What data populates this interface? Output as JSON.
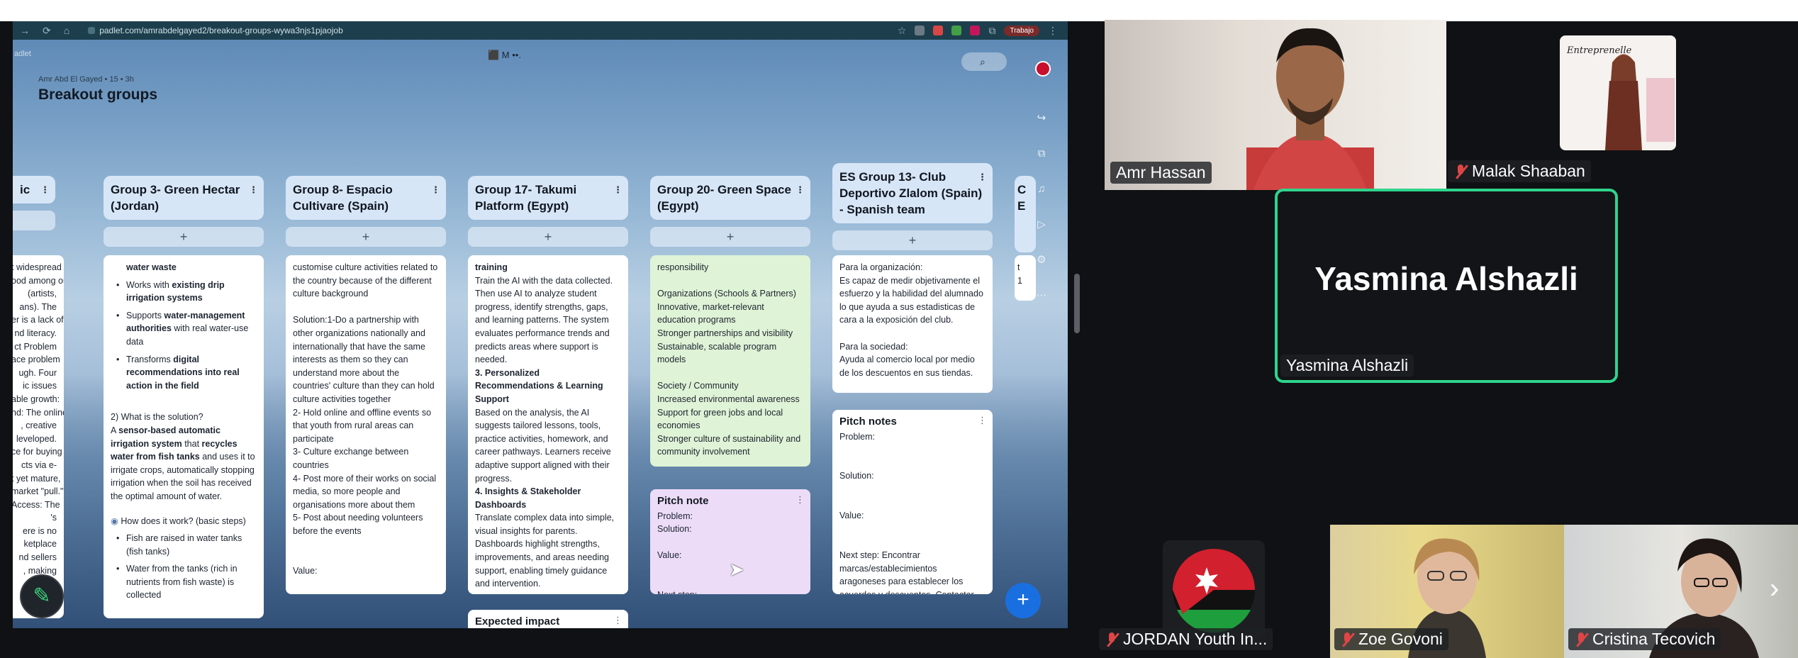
{
  "browser": {
    "url": "padlet.com/amrabdelgayed2/breakout-groups-wywa3njs1pjaojob",
    "profile_label": "Trabajo"
  },
  "board": {
    "app_label": "adlet",
    "byline": "Amr Abd El Gayed • 15 • 3h",
    "title": "Breakout groups",
    "top_icons": "⬛ M ••.",
    "search_icon": "search-icon"
  },
  "columns": [
    {
      "title": "ic",
      "add": "+"
    },
    {
      "title": "Group 3- Green Hectar (Jordan)",
      "add": "+"
    },
    {
      "title": "Group 8- Espacio Cultivare (Spain)",
      "add": "+"
    },
    {
      "title": "Group 17- Takumi Platform (Egypt)",
      "add": "+"
    },
    {
      "title": "Group 20- Green Space (Egypt)",
      "add": "+"
    },
    {
      "title": "ES Group 13- Club Deportivo Zlalom (Spain) - Spanish team",
      "add": "+"
    },
    {
      "title": "C E",
      "add": ""
    }
  ],
  "cards": {
    "col0": [
      "t widespread",
      "ood among our",
      "(artists,",
      "ans). The",
      "er is a lack of",
      "nd literacy.",
      "ct Problem",
      "ace problem",
      "ugh. Four",
      "ic issues",
      "able growth:",
      "nd: The online",
      ", creative",
      "leveloped.",
      "ce for buying",
      "cts via e-",
      "t yet mature,",
      "market \"pull.\"",
      "Access: The",
      "'s",
      "ere is no",
      "ketplace",
      "nd sellers",
      ", making"
    ],
    "col1_top": "water waste",
    "col1_bullets": [
      {
        "pre": "Works with ",
        "bold": "existing drip irrigation systems",
        "post": ""
      },
      {
        "pre": "Supports ",
        "bold": "water-management authorities",
        "post": " with real water-use data"
      },
      {
        "pre": "Transforms ",
        "bold": "digital recommendations into real action in the field",
        "post": ""
      }
    ],
    "col1_q2": "2) What is the solution?",
    "col1_sol_a": "A ",
    "col1_sol_b": "sensor-based automatic irrigation system",
    "col1_sol_c": " that ",
    "col1_sol_d": "recycles water from fish tanks",
    "col1_sol_e": " and uses it to irrigate crops, automatically stopping irrigation when the soil has received the optimal amount of water.",
    "col1_how": "How does it work? (basic steps)",
    "col1_steps": [
      "Fish are raised in water tanks (fish tanks)",
      "Water from the tanks (rich in nutrients from fish waste) is collected"
    ],
    "col2": "customise culture activities related to the country because of the different culture background\n\nSolution:1-Do a partnership with other organizations nationally and internationally that have the same interests as them so they can understand more about the countries' culture than they can hold culture activities together\n2- Hold online and offline events so that youth from rural areas can participate\n3- Culture exchange between countries\n4- Post more of their works on social media, so more people and organisations more about them\n5- Post about needing volunteers before the events\n\n\nValue:\n\n\nNext step:",
    "col3_a": "training",
    "col3_b": "Train the AI with the data collected. Then use AI to analyze student progress, identify strengths, gaps, and learning patterns. The system evaluates performance trends and predicts areas where support is needed.",
    "col3_h1": "3. Personalized Recommendations & Learning Support",
    "col3_c": "Based on the analysis, the AI suggests tailored lessons, tools, practice activities, homework, and career pathways. Learners receive adaptive support aligned with their progress.",
    "col3_h2": "4. Insights & Stakeholder Dashboards",
    "col3_d": "Translate complex data into simple, visual insights for parents. Dashboards highlight strengths, improvements, and areas needing support, enabling timely guidance and intervention.",
    "col3_next_title": "Expected impact",
    "col4_green": "responsibility\n\nOrganizations (Schools & Partners)\nInnovative, market-relevant education programs\nStronger partnerships and visibility\nSustainable, scalable program models\n\nSociety / Community\nIncreased environmental awareness\nSupport for green jobs and local economies\nStronger culture of sustainability and community involvement",
    "col4_pitch_title": "Pitch note",
    "col4_pitch_body": "Problem:\nSolution:\n\nValue:\n\n\nNext step:",
    "col5_top": "Para la organización:\nEs capaz de medir objetivamente el esfuerzo y la habilidad del alumnado lo que ayuda a sus estadisticas de cara a la exposición del club.\n\nPara la sociedad:\nAyuda al comercio local por medio de los descuentos en sus tiendas.",
    "col5_pitch_title": "Pitch notes",
    "col5_pitch_body": "Problem:\n\n\nSolution:\n\n\nValue:\n\n\nNext step: Encontrar marcas/establecimientos aragoneses para establecer los acuerdos y descuentos. Contactar con FEARPA para dar a conocer la aplicación en otros clubs.",
    "col6": "t\n1"
  },
  "fab_label": "+",
  "participants": {
    "amr": "Amr Hassan",
    "malak": "Malak Shaaban",
    "yasmina_big": "Yasmina Alshazli",
    "yasmina": "Yasmina Alshazli",
    "jordan": "JORDAN Youth In...",
    "zoe": "Zoe Govoni",
    "cristina": "Cristina Tecovich",
    "malak_poster": "Entreprenelle"
  },
  "colors": {
    "speaker_border": "#2fd48c",
    "muted": "#e04545",
    "card_green": "#dff3d6",
    "card_purple": "#ecdcf8"
  }
}
